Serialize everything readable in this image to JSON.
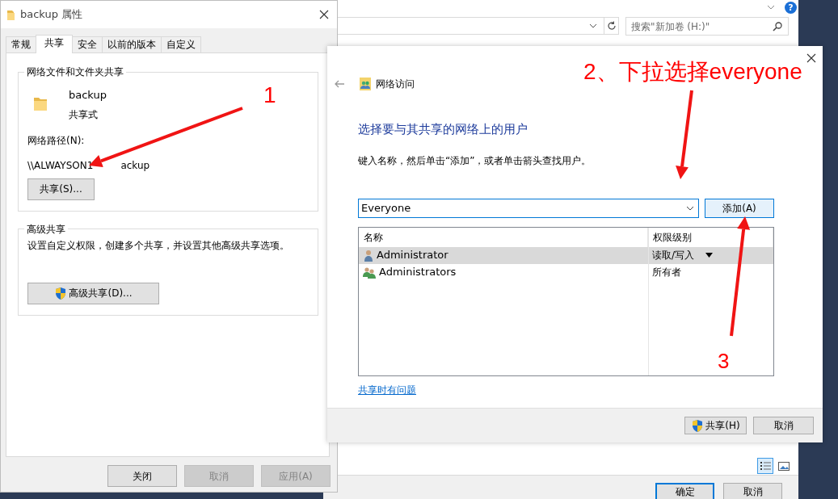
{
  "explorer": {
    "help_button": "?",
    "search": {
      "placeholder": "搜索\"新加卷 (H:)\""
    },
    "views": [
      {
        "kind": "details",
        "selected": true
      },
      {
        "kind": "preview",
        "selected": false
      }
    ],
    "buttons": [
      {
        "label": "确定",
        "default": true
      },
      {
        "label": "取消",
        "default": false
      }
    ]
  },
  "properties_dialog": {
    "title": "backup 属性",
    "tabs": [
      {
        "label": "常规",
        "selected": false
      },
      {
        "label": "共享",
        "selected": true
      },
      {
        "label": "安全",
        "selected": false
      },
      {
        "label": "以前的版本",
        "selected": false
      },
      {
        "label": "自定义",
        "selected": false
      }
    ],
    "sharing_group": {
      "title": "网络文件和文件夹共享",
      "folder_name": "backup",
      "folder_state": "共享式",
      "path_label": "网络路径(N):",
      "path_parts": [
        "\\\\ALWAYSON1",
        "ackup"
      ],
      "button": "共享(S)..."
    },
    "advanced_group": {
      "title": "高级共享",
      "description": "设置自定义权限，创建多个共享，并设置其他高级共享选项。",
      "button": "高级共享(D)..."
    },
    "buttons": [
      {
        "label": "关闭",
        "disabled": false
      },
      {
        "label": "取消",
        "disabled": true
      },
      {
        "label": "应用(A)",
        "disabled": true
      }
    ]
  },
  "network_access_dialog": {
    "title": "网络访问",
    "heading": "选择要与其共享的网络上的用户",
    "instruction": "键入名称，然后单击“添加”，或者单击箭头查找用户。",
    "user_field": {
      "value": "Everyone"
    },
    "add_button": "添加(A)",
    "columns": [
      "名称",
      "权限级别"
    ],
    "users": [
      {
        "name": "Administrator",
        "kind": "user",
        "permission": "读取/写入",
        "selected": true
      },
      {
        "name": "Administrators",
        "kind": "group",
        "permission": "所有者",
        "selected": false
      }
    ],
    "help_link": "共享时有问题",
    "buttons": [
      {
        "label": "共享(H)",
        "shield": true
      },
      {
        "label": "取消",
        "shield": false
      }
    ]
  },
  "annotations": [
    {
      "label": "1"
    },
    {
      "label": "2、下拉选择everyone"
    },
    {
      "label": "3"
    }
  ]
}
